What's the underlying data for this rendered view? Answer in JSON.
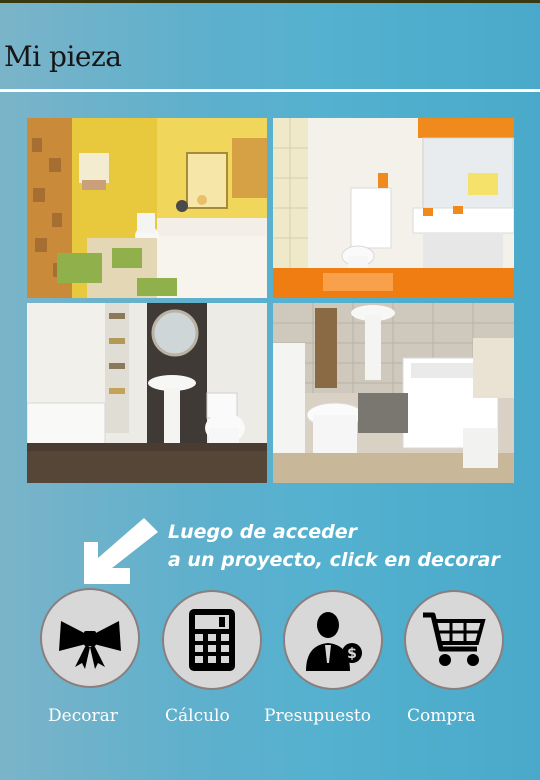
{
  "header": {
    "title": "Mi pieza"
  },
  "gallery": [
    {
      "scene": "yellow-bathroom-photo"
    },
    {
      "scene": "orange-white-bathroom-photo"
    },
    {
      "scene": "dark-tile-bathroom-photo"
    },
    {
      "scene": "beige-tile-bathroom-photo"
    }
  ],
  "hint": {
    "line1": "Luego de acceder",
    "line2": "a un proyecto, click en decorar"
  },
  "actions": [
    {
      "label": "Decorar",
      "icon": "bow-icon"
    },
    {
      "label": "Cálculo",
      "icon": "calculator-icon"
    },
    {
      "label": "Presupuesto",
      "icon": "businessman-dollar-icon"
    },
    {
      "label": "Compra",
      "icon": "shopping-cart-icon"
    }
  ],
  "colors": {
    "background": "#54b1cf",
    "text": "#ffffff",
    "title": "#161616"
  }
}
